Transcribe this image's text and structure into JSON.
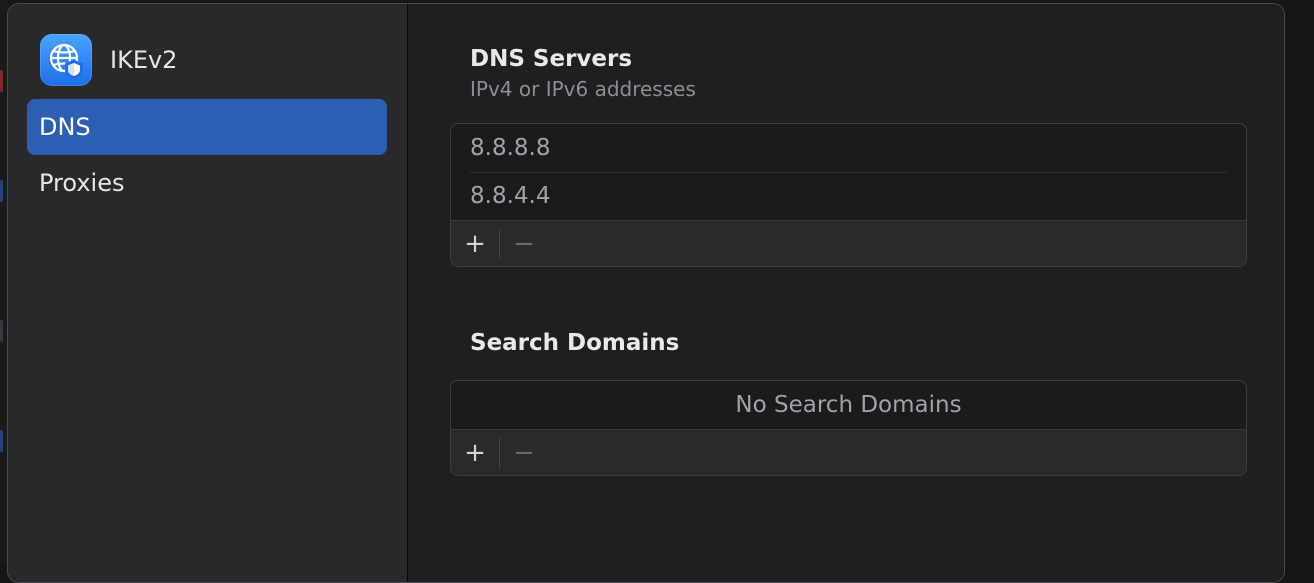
{
  "app": {
    "title": "IKEv2",
    "icon": "globe-shield-icon",
    "accent": "#2c5fb3"
  },
  "sidebar": {
    "items": [
      {
        "label": "DNS",
        "selected": true
      },
      {
        "label": "Proxies",
        "selected": false
      }
    ]
  },
  "dns_servers": {
    "title": "DNS Servers",
    "subtitle": "IPv4 or IPv6 addresses",
    "entries": [
      "8.8.8.8",
      "8.8.4.4"
    ],
    "add_label": "+",
    "remove_label": "−"
  },
  "search_domains": {
    "title": "Search Domains",
    "empty_text": "No Search Domains",
    "add_label": "+",
    "remove_label": "−"
  }
}
